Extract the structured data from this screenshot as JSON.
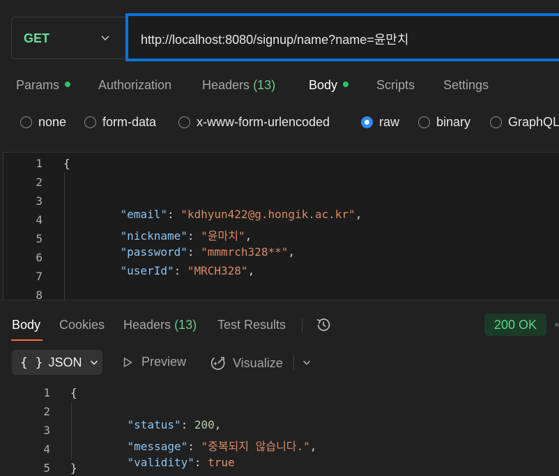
{
  "request": {
    "method": "GET",
    "url": "http://localhost:8080/signup/name?name=윤만치"
  },
  "request_tabs": [
    {
      "label": "Params",
      "dot": true
    },
    {
      "label": "Authorization"
    },
    {
      "label": "Headers",
      "count": "(13)"
    },
    {
      "label": "Body",
      "dot": true,
      "active": true
    },
    {
      "label": "Scripts"
    },
    {
      "label": "Settings"
    }
  ],
  "body_types": [
    "none",
    "form-data",
    "x-www-form-urlencoded",
    "raw",
    "binary",
    "GraphQL"
  ],
  "body_type_selected": "raw",
  "request_body": {
    "line_numbers": [
      "1",
      "2",
      "3",
      "4",
      "5",
      "6",
      "7",
      "8"
    ],
    "open_brace": "{",
    "fields": [
      {
        "key": "\"email\"",
        "value": "\"kdhyun422@g.hongik.ac.kr\""
      },
      {
        "key": "\"nickname\"",
        "value": "\"윤마치\""
      },
      {
        "key": "\"password\"",
        "value": "\"mmmrch328**\""
      },
      {
        "key": "\"userId\"",
        "value": "\"MRCH328\""
      }
    ],
    "colon": ": ",
    "comma": ","
  },
  "response_tabs": [
    {
      "label": "Body",
      "active": true
    },
    {
      "label": "Cookies"
    },
    {
      "label": "Headers",
      "count": "(13)"
    },
    {
      "label": "Test Results"
    }
  ],
  "status": "200 OK",
  "view": {
    "format": "JSON",
    "preview": "Preview",
    "visualize": "Visualize"
  },
  "response_body": {
    "line_numbers": [
      "1",
      "2",
      "3",
      "4",
      "5"
    ],
    "open_brace": "{",
    "close_brace": "}",
    "status_key": "\"status\"",
    "status_value": "200",
    "message_key": "\"message\"",
    "message_value": "\"중복되지 않습니다.\"",
    "validity_key": "\"validity\"",
    "validity_value": "true",
    "colon": ": ",
    "comma": ","
  },
  "colors": {
    "accent_blue": "#0a74d8",
    "method_green": "#6bdd9a",
    "status_green": "#57d68a",
    "tab_underline": "#ff6c37"
  }
}
